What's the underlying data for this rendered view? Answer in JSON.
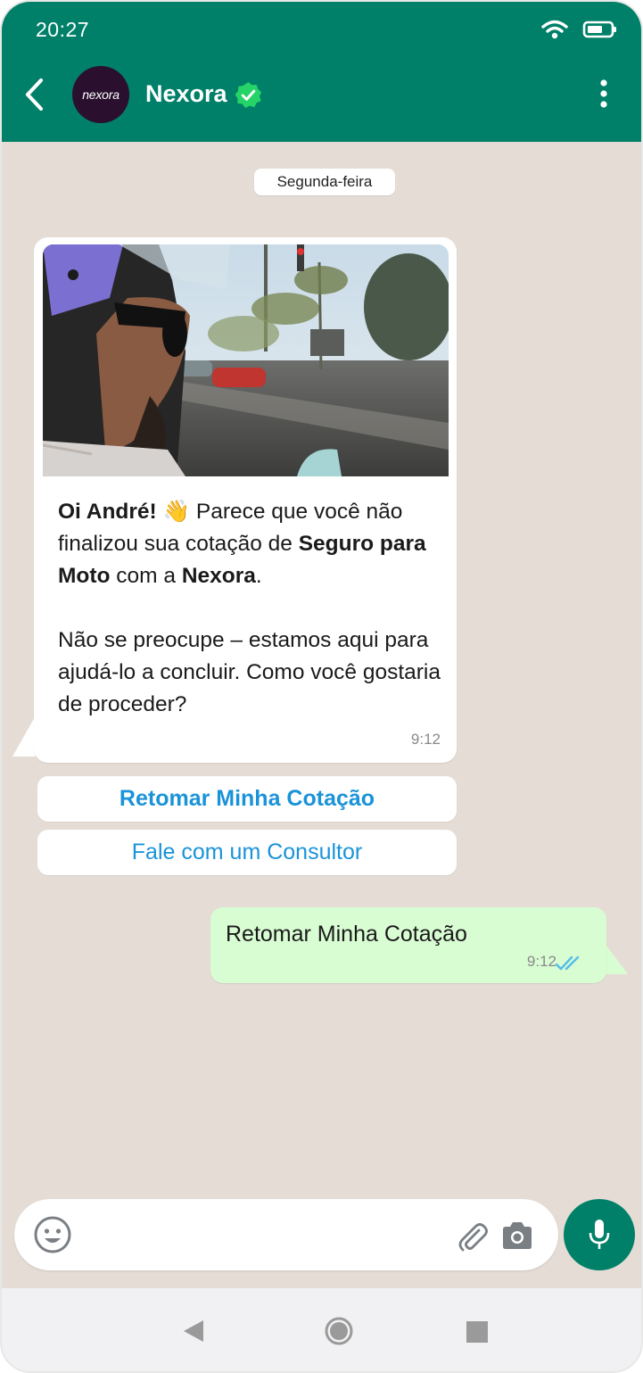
{
  "status_bar": {
    "time": "20:27"
  },
  "header": {
    "contact_name": "Nexora",
    "avatar_text": "nexora"
  },
  "chat": {
    "date_label": "Segunda-feira",
    "incoming": {
      "line1_bold": "Oi André!",
      "line1_emoji": "👋",
      "line1_rest": " Parece que você não finalizou sua cotação de ",
      "bold_product": "Seguro para Moto",
      "mid": " com a ",
      "bold_brand": "Nexora",
      "end": ".",
      "paragraph2": "Não se preocupe – estamos aqui para ajudá-lo a concluir. Como você gostaria de proceder?",
      "time": "9:12"
    },
    "quick_replies": [
      "Retomar Minha Cotação",
      "Fale com um Consultor"
    ],
    "outgoing": {
      "text": "Retomar Minha Cotação",
      "time": "9:12"
    }
  },
  "colors": {
    "header": "#008069",
    "chat_bg": "#e5ddd5",
    "outgoing_bubble": "#d9fdd3",
    "link": "#1a93d9",
    "read_ticks": "#53bdeb"
  }
}
